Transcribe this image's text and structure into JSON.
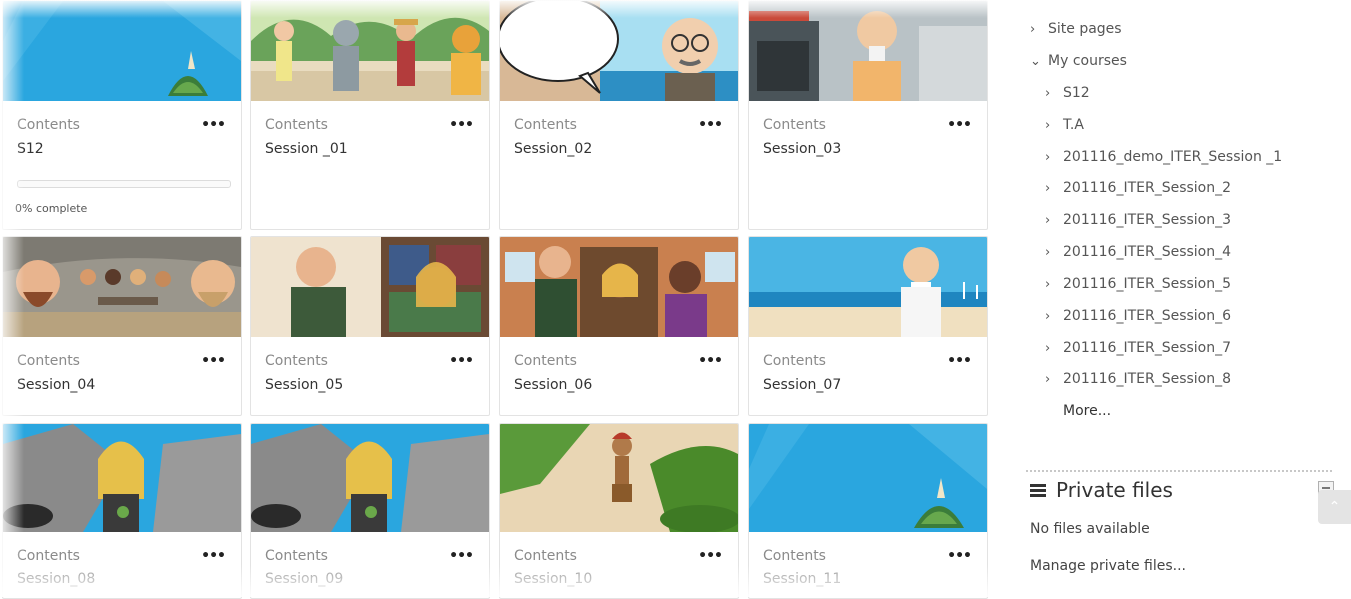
{
  "courses": [
    {
      "category": "Contents",
      "title": "S12",
      "progress_pct": 0,
      "progress_text": "0% complete",
      "thumb": "tropical-island"
    },
    {
      "category": "Contents",
      "title": "Session _01",
      "thumb": "cartoon-characters-jungle"
    },
    {
      "category": "Contents",
      "title": "Session_02",
      "thumb": "old-man-speech-bubble"
    },
    {
      "category": "Contents",
      "title": "Session_03",
      "thumb": "old-man-factory"
    },
    {
      "category": "Contents",
      "title": "Session_04",
      "thumb": "cave-people"
    },
    {
      "category": "Contents",
      "title": "Session_05",
      "thumb": "library-characters"
    },
    {
      "category": "Contents",
      "title": "Session_06",
      "thumb": "house-door-characters"
    },
    {
      "category": "Contents",
      "title": "Session_07",
      "thumb": "old-man-beach"
    },
    {
      "category": "Contents",
      "title": "Session_08",
      "thumb": "girl-cave"
    },
    {
      "category": "Contents",
      "title": "Session_09",
      "thumb": "girl-cave"
    },
    {
      "category": "Contents",
      "title": "Session_10",
      "thumb": "girl-jungle"
    },
    {
      "category": "Contents",
      "title": "Session_11",
      "thumb": "tropical-island"
    }
  ],
  "card_menu_label": "•••",
  "nav": {
    "site_pages": "Site pages",
    "my_courses": "My courses",
    "courses": [
      "S12",
      "T.A",
      "201116_demo_ITER_Session _1",
      "201116_ITER_Session_2",
      "201116_ITER_Session_3",
      "201116_ITER_Session_4",
      "201116_ITER_Session_5",
      "201116_ITER_Session_6",
      "201116_ITER_Session_7",
      "201116_ITER_Session_8"
    ],
    "more": "More..."
  },
  "private_files": {
    "title": "Private files",
    "empty_text": "No files available",
    "manage_link": "Manage private files..."
  },
  "icons": {
    "chevron_right": "›",
    "chevron_down": "⌄",
    "scroll_up": "⌃"
  },
  "colors": {
    "sky": "#29a3dc",
    "progress": "#5b9bd5"
  }
}
